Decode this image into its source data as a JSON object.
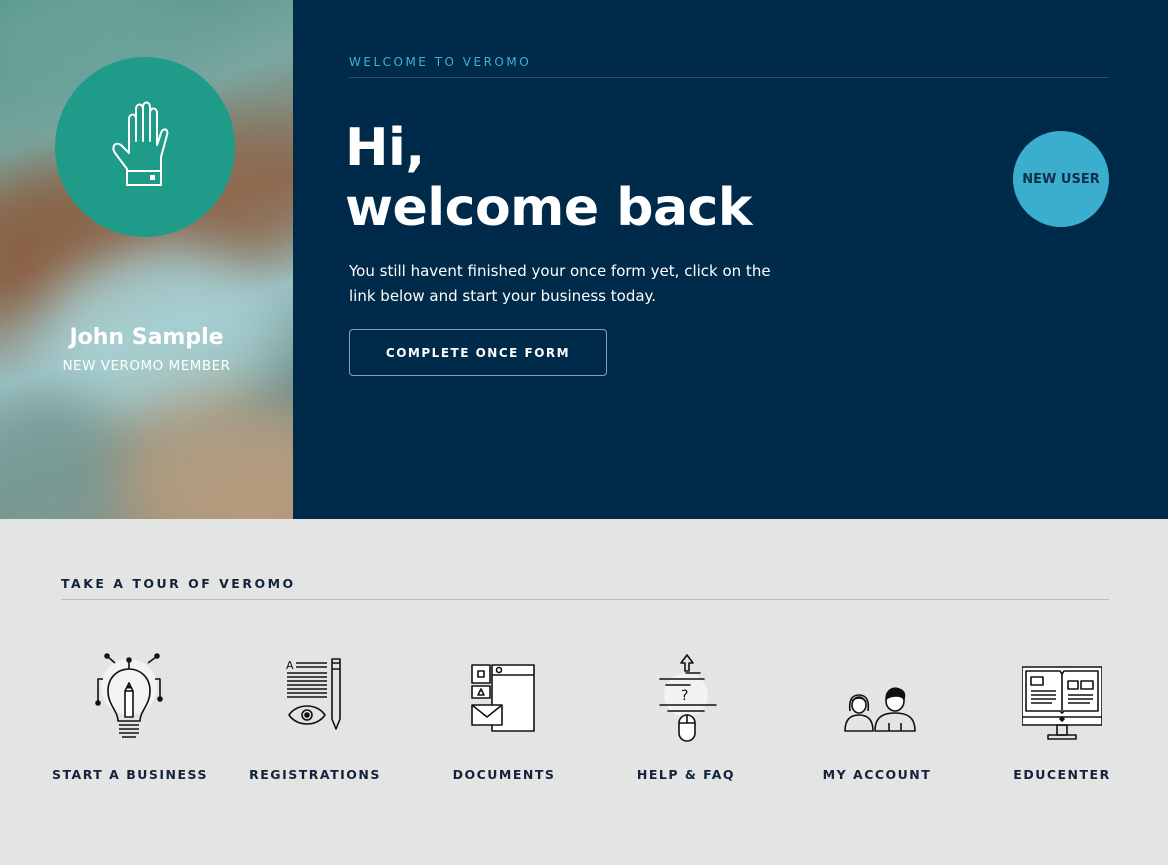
{
  "profile": {
    "name": "John Sample",
    "role": "NEW VEROMO MEMBER",
    "avatar_icon": "hand-icon",
    "avatar_color": "#1f9b8a"
  },
  "welcome": {
    "eyebrow": "WELCOME TO VEROMO",
    "headline_line1": "Hi,",
    "headline_line2": "welcome back",
    "intro_line1": "You still havent finished your once form yet, click on the",
    "intro_line2": "link below and start your business today.",
    "cta_label": "COMPLETE ONCE FORM",
    "badge_label": "NEW USER",
    "background_color": "#002a4a",
    "accent_color": "#3aaecc"
  },
  "tour": {
    "title": "TAKE A TOUR OF VEROMO",
    "items": [
      {
        "label": "START A BUSINESS",
        "icon": "lightbulb-pencil-icon"
      },
      {
        "label": "REGISTRATIONS",
        "icon": "document-eye-icon"
      },
      {
        "label": "DOCUMENTS",
        "icon": "documents-icon"
      },
      {
        "label": "HELP & FAQ",
        "icon": "help-mouse-icon"
      },
      {
        "label": "MY ACCOUNT",
        "icon": "users-icon"
      },
      {
        "label": "EDUCENTER",
        "icon": "monitor-book-icon"
      }
    ]
  }
}
